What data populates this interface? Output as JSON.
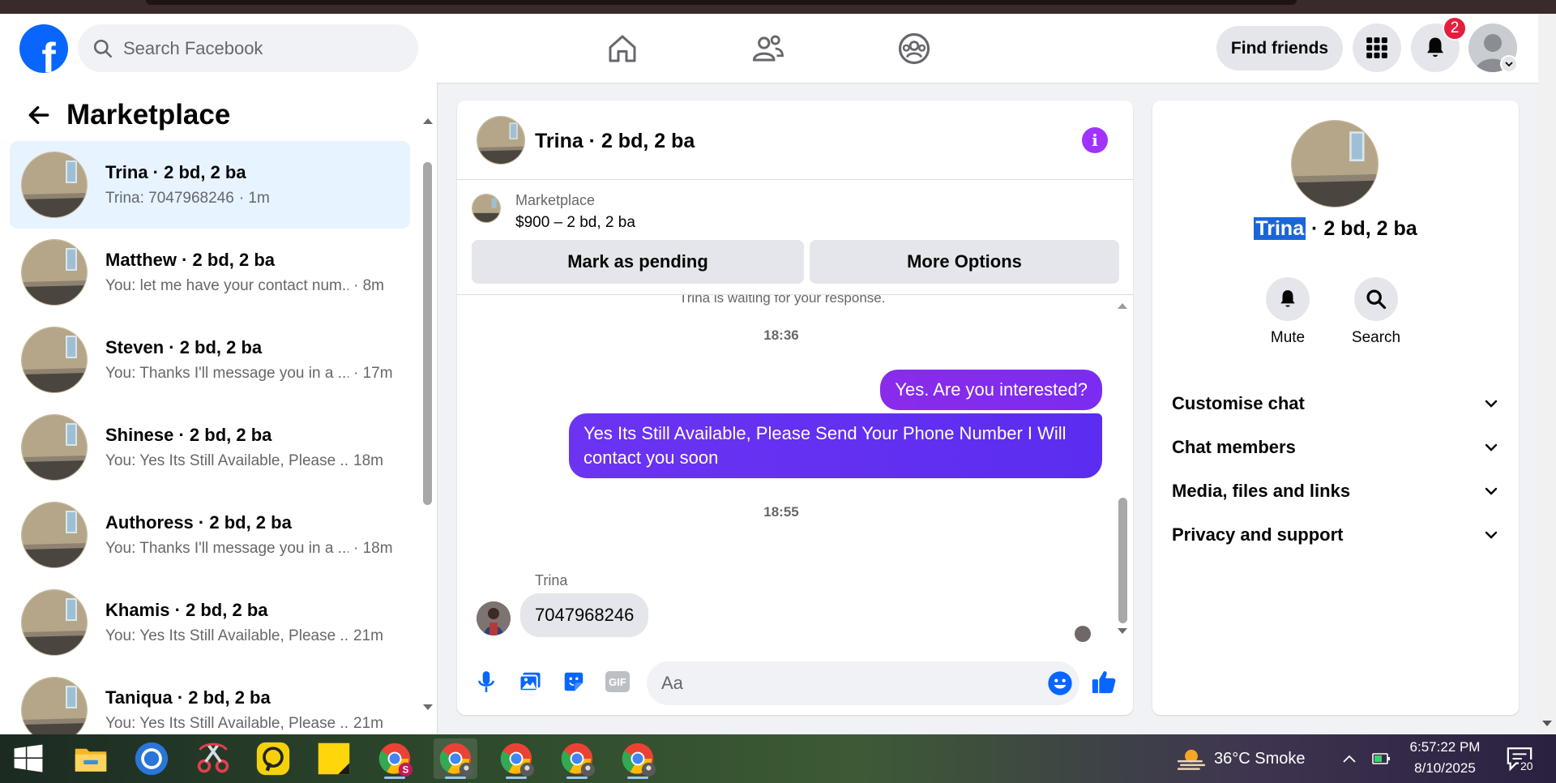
{
  "header": {
    "logo_letter": "f",
    "search_placeholder": "Search Facebook",
    "find_friends_label": "Find friends",
    "notification_count": "2"
  },
  "sidebar": {
    "title": "Marketplace",
    "conversations": [
      {
        "name": "Trina · 2 bd, 2 ba",
        "preview": "Trina: 7047968246",
        "time": "· 1m",
        "active": true
      },
      {
        "name": "Matthew · 2 bd, 2 ba",
        "preview": "You: let me have your contact num...",
        "time": "· 8m"
      },
      {
        "name": "Steven · 2 bd, 2 ba",
        "preview": "You: Thanks I'll message you in a ...",
        "time": "· 17m"
      },
      {
        "name": "Shinese · 2 bd, 2 ba",
        "preview": "You: Yes Its Still Available, Please ...",
        "time": "18m"
      },
      {
        "name": "Authoress · 2 bd, 2 ba",
        "preview": "You: Thanks I'll message you in a ...",
        "time": "· 18m"
      },
      {
        "name": "Khamis · 2 bd, 2 ba",
        "preview": "You: Yes Its Still Available, Please ...",
        "time": "21m"
      },
      {
        "name": "Taniqua · 2 bd, 2 ba",
        "preview": "You: Yes Its Still Available, Please ...",
        "time": "21m"
      }
    ]
  },
  "chat": {
    "title": "Trina · 2 bd, 2 ba",
    "listing_source": "Marketplace",
    "listing_price": "$900 – 2 bd, 2 ba",
    "mark_pending_label": "Mark as pending",
    "more_options_label": "More Options",
    "cut_text": "Trina is waiting for your response.",
    "time_1": "18:36",
    "outgoing_1": "Yes. Are you interested?",
    "outgoing_2": "Yes Its Still Available, Please Send Your Phone Number I Will contact you soon",
    "time_2": "18:55",
    "sender": "Trina",
    "incoming_1": "7047968246",
    "input_placeholder": "Aa",
    "gif_label": "GIF"
  },
  "info": {
    "name_highlight": "Trina",
    "name_rest": " · 2 bd, 2 ba",
    "mute_label": "Mute",
    "search_label": "Search",
    "sections": [
      "Customise chat",
      "Chat members",
      "Media, files and links",
      "Privacy and support"
    ]
  },
  "taskbar": {
    "weather": "36°C  Smoke",
    "time": "6:57:22 PM",
    "date": "8/10/2025",
    "notif_count": "20"
  },
  "colors": {
    "brand_blue": "#0866ff",
    "outgoing_bubble": "#7a2cf0",
    "active_conv_bg": "#e7f3ff",
    "info_purple": "#a033ff"
  }
}
